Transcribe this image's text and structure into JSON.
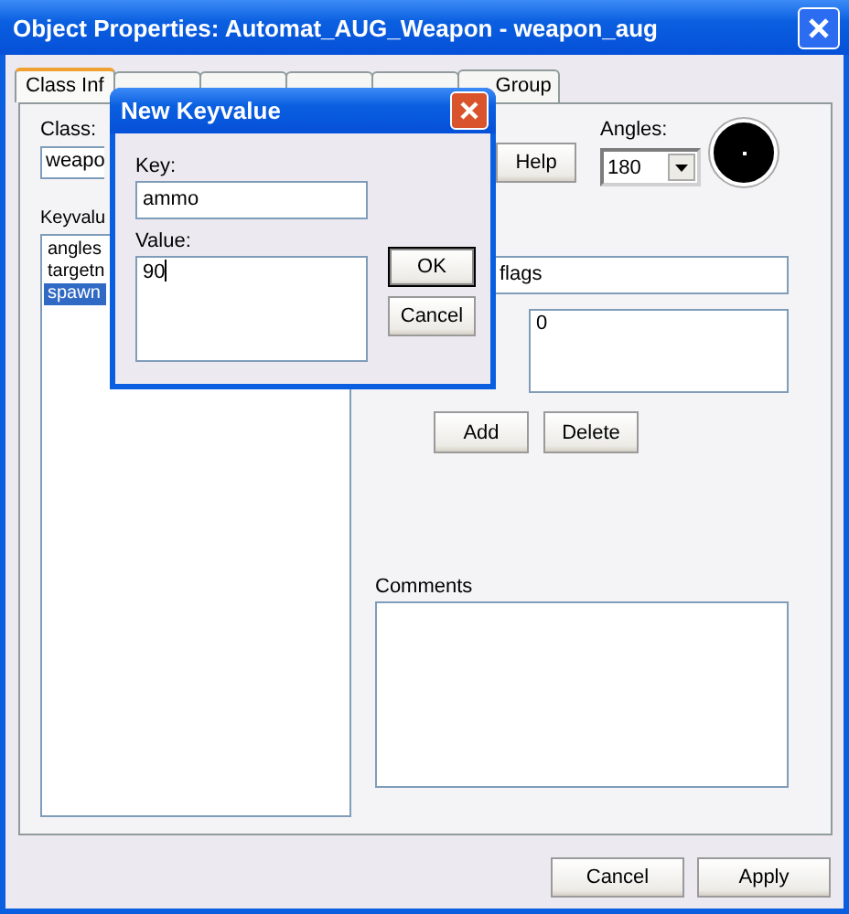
{
  "window": {
    "title": "Object Properties: Automat_AUG_Weapon - weapon_aug"
  },
  "tabs": [
    {
      "label": "Class Inf",
      "selected": true
    },
    {
      "selected": false
    },
    {
      "selected": false
    },
    {
      "selected": false
    },
    {
      "selected": false
    },
    {
      "label": "Group",
      "selected": false
    }
  ],
  "class": {
    "label": "Class:",
    "value": "weapo"
  },
  "help_button": "Help",
  "angles": {
    "label": "Angles:",
    "value": "180"
  },
  "keyvalues": {
    "label": "Keyvalu",
    "items": [
      {
        "text": "angles",
        "selected": false
      },
      {
        "text": "targetn",
        "selected": false
      },
      {
        "text": "spawn",
        "selected": true
      }
    ]
  },
  "key_field": {
    "value": "flags"
  },
  "value_field": {
    "value": "0"
  },
  "buttons": [
    "Add",
    "Delete"
  ],
  "comments": {
    "label": "Comments"
  },
  "footer_buttons": [
    "Cancel",
    "Apply"
  ],
  "dialog": {
    "title": "New Keyvalue",
    "key": {
      "label": "Key:",
      "value": "ammo"
    },
    "value": {
      "label": "Value:",
      "value": "90"
    },
    "buttons": [
      {
        "label": "OK",
        "default": true
      },
      {
        "label": "Cancel",
        "default": false
      }
    ]
  }
}
